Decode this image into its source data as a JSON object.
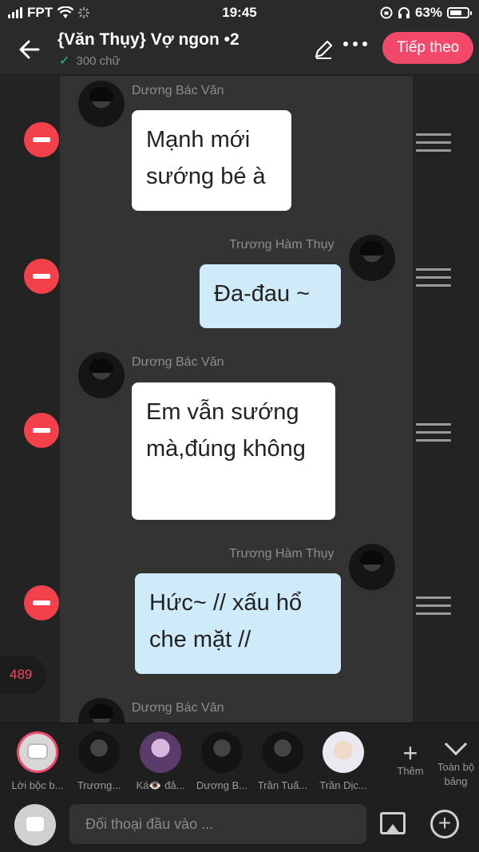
{
  "status": {
    "carrier": "FPT",
    "time": "19:45",
    "battery": "63%"
  },
  "header": {
    "title": "{Văn Thụy} Vợ ngon •2",
    "word_count": "300 chữ",
    "next_label": "Tiếp theo"
  },
  "messages": [
    {
      "sender": "Dương Bác Văn",
      "text": "Mạnh mới sướng bé à"
    },
    {
      "sender": "Trương Hàm Thụy",
      "text": "Đa-đau ~"
    },
    {
      "sender": "Dương Bác Văn",
      "text": "Em vẫn sướng mà,đúng không"
    },
    {
      "sender": "Trương Hàm Thụy",
      "text": "Hức~ // xấu hổ che mặt //"
    },
    {
      "sender": "Dương Bác Văn",
      "text": ""
    }
  ],
  "counter": "489",
  "characters": [
    {
      "label": "Lời bộc b..."
    },
    {
      "label": "Trương..."
    },
    {
      "label": "Ká👁️ đả..."
    },
    {
      "label": "Dương B..."
    },
    {
      "label": "Trần Tuấ..."
    },
    {
      "label": "Trần Dịc..."
    }
  ],
  "add_label": "Thêm",
  "all_label": "Toàn bộ bảng",
  "input": {
    "placeholder": "Đối thoại đầu vào ..."
  },
  "colors": {
    "accent": "#f2496b",
    "delete": "#f2414b",
    "bubble_right": "#cfeaf8"
  }
}
